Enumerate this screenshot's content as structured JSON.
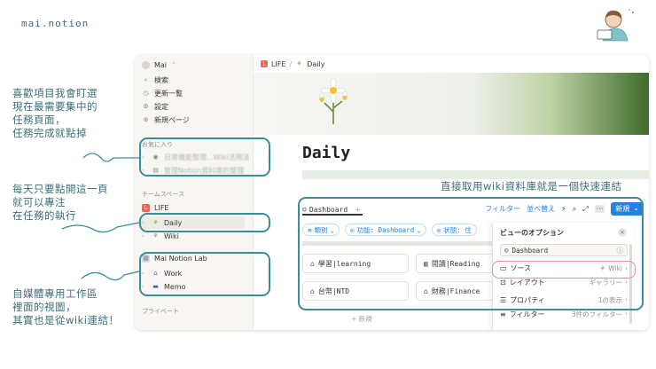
{
  "brand": "mai.notion",
  "sidebar": {
    "workspace": "Mai",
    "search": "検索",
    "updates": "更新一覧",
    "settings": "設定",
    "new_page": "新規ページ",
    "favorites_header": "お気に入り",
    "fav_1": "日常機能整理...Wiki活用法",
    "fav_2": "管理Notion資料庫的整理",
    "teamspace_header": "チームスペース",
    "life": "LIFE",
    "daily": "Daily",
    "wiki": "Wiki",
    "lab": "Mai Notion Lab",
    "work": "Work",
    "memo": "Memo",
    "private_header": "プライベート"
  },
  "topbar": {
    "breadcrumb_parent": "LIFE",
    "breadcrumb_sep": "/",
    "breadcrumb_current": "Daily"
  },
  "page": {
    "title": "Daily"
  },
  "database": {
    "tab": "Dashboard",
    "add_tab": "+",
    "filter": "フィルター",
    "sort": "並べ替え",
    "new": "新規",
    "chip_category": "類別",
    "chip_function": "功能: Dashboard",
    "chip_status": "状態: 住",
    "cards": [
      {
        "label": "學習|learning"
      },
      {
        "label": "閱讀|Reading"
      },
      {
        "label": "台幣|NTD"
      },
      {
        "label": "財務|Finance"
      }
    ],
    "add_new": "+ 新規"
  },
  "popup": {
    "title": "ビューのオプション",
    "close": "×",
    "view_name": "Dashboard",
    "source_label": "ソース",
    "source_value": "Wiki",
    "layout_label": "レイアウト",
    "layout_value": "ギャラリー",
    "property_label": "プロパティ",
    "property_value": "1の表示",
    "filter_label": "フィルター",
    "filter_value": "3件のフィルター"
  },
  "annotations": {
    "favorites_note": [
      "喜歡項目我會盯選",
      "現在最需要集中的",
      "任務頁面，",
      "任務完成就點掉"
    ],
    "daily_note": [
      "每天只要點開這一頁",
      "就可以專注",
      "在任務的執行"
    ],
    "lab_note": [
      "自媒體專用工作區",
      "裡面的視圖，",
      "其實也是從wiki連結！"
    ],
    "db_note": "直接取用wiki資料庫就是一個快速連結"
  },
  "colors": {
    "accent": "#2383e2",
    "annotation": "#3a6f78",
    "frame": "#3a8f97",
    "source_highlight": "#e58fa3"
  }
}
